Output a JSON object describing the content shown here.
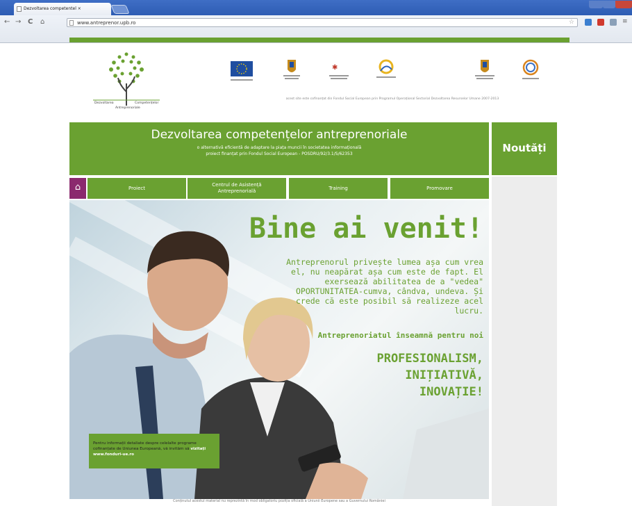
{
  "browser": {
    "tab_title": "Dezvoltarea competentel ×",
    "url": "www.antreprenor.upb.ro"
  },
  "sponsors": {
    "text": "acest site este cofinanțat din Fondul Social European prin Programul Operațional Sectorial Dezvoltarea Resurselor Umane 2007-2013"
  },
  "logo": {
    "caption_left": "Dezvoltarea",
    "caption_right": "Competențelor",
    "caption_bottom": "Antreprenoriale"
  },
  "banner": {
    "title": "Dezvoltarea competențelor antreprenoriale",
    "line1": "o alternativă eficientă de adaptare la piața muncii în societatea informațională",
    "line2": "proiect finanțat prin Fondul Social European - POSDRU/92/3.1/S/62353"
  },
  "news": {
    "title": "Noutăți"
  },
  "nav": {
    "home": "⌂",
    "items": [
      {
        "label": "Proiect"
      },
      {
        "label": "Centrul de Asistență Antreprenorială"
      },
      {
        "label": "Training"
      },
      {
        "label": "Promovare"
      }
    ]
  },
  "hero": {
    "title": "Bine ai venit!",
    "quote": "Antreprenorul privește lumea așa cum vrea el, nu neapărat așa cum este de fapt. El exersează abilitatea de a \"vedea\" OPORTUNITATEA-cumva, cândva, undeva. Și crede că este posibil să realizeze acel lucru.",
    "subtitle": "Antreprenoriatul înseamnă pentru noi",
    "words": [
      "PROFESIONALISM,",
      "INIȚIATIVĂ,",
      "INOVAȚIE!"
    ]
  },
  "infobox": {
    "text": "Pentru informații detaliate despre celelalte programe cofinanțate de Uniunea Europeană, vă invităm să",
    "link": "vizitați www.fonduri-ue.ro"
  },
  "disclaimer": "Conținutul acestui material nu reprezintă în mod obligatoriu poziția oficială a Uniunii Europene sau a Guvernului României",
  "colors": {
    "brand_green": "#6aa131",
    "home_purple": "#8b2a6e",
    "chrome_blue": "#3f6ec5"
  }
}
